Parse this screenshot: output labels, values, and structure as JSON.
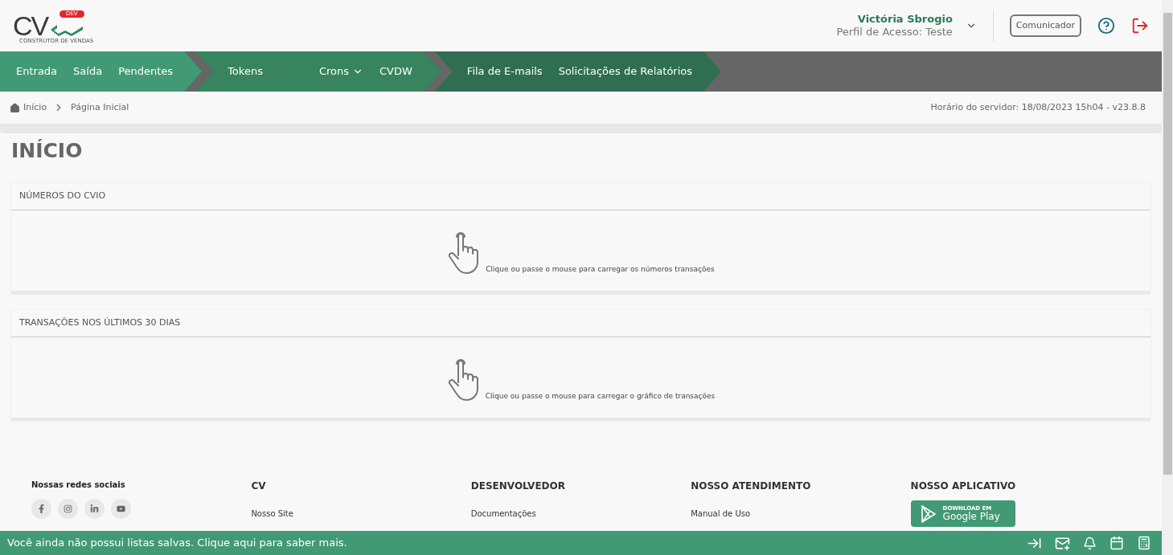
{
  "logo": {
    "letters": "CV",
    "badge": "DEV",
    "tagline": "CONSTRUTOR DE VENDAS"
  },
  "user": {
    "name": "Victória Sbrogio",
    "profile": "Perfil de Acesso: Teste"
  },
  "header_buttons": {
    "communicator": "Comunicador"
  },
  "nav": [
    {
      "items": [
        {
          "label": "Entrada",
          "kind": "link"
        },
        {
          "label": "Saída",
          "kind": "link"
        },
        {
          "label": "Pendentes",
          "kind": "link"
        }
      ]
    },
    {
      "items": [
        {
          "label": "Tokens",
          "kind": "link"
        },
        {
          "label": "Crons",
          "kind": "dropdown"
        },
        {
          "label": "CVDW",
          "kind": "link"
        }
      ]
    },
    {
      "items": [
        {
          "label": "Fila de E-mails",
          "kind": "link"
        },
        {
          "label": "Solicitações de Relatórios",
          "kind": "link"
        }
      ]
    }
  ],
  "breadcrumb": [
    "Início",
    "Página Inicial"
  ],
  "server_time": "Horário do servidor: 18/08/2023 15h04 - v23.8.8",
  "page_title": "INÍCIO",
  "panels": [
    {
      "title": "NÚMEROS DO CVIO",
      "hint": "Clique ou passe o mouse para carregar os números transações"
    },
    {
      "title": "TRANSAÇÕES NOS ÚLTIMOS 30 DIAS",
      "hint": "Clique ou passe o mouse para carregar o gráfico de transações"
    }
  ],
  "footer": {
    "social_title": "Nossas redes sociais",
    "columns": [
      {
        "title": "CV",
        "link": "Nosso Site"
      },
      {
        "title": "DESENVOLVEDOR",
        "link": "Documentações"
      },
      {
        "title": "NOSSO ATENDIMENTO",
        "link": "Manual de Uso"
      }
    ],
    "app_title": "NOSSO APLICATIVO",
    "store": {
      "small": "DOWNLOAD EM",
      "big": "Google Play"
    }
  },
  "bottom_bar": {
    "message": "Você ainda não possui listas salvas. Clique aqui para saber mais."
  }
}
